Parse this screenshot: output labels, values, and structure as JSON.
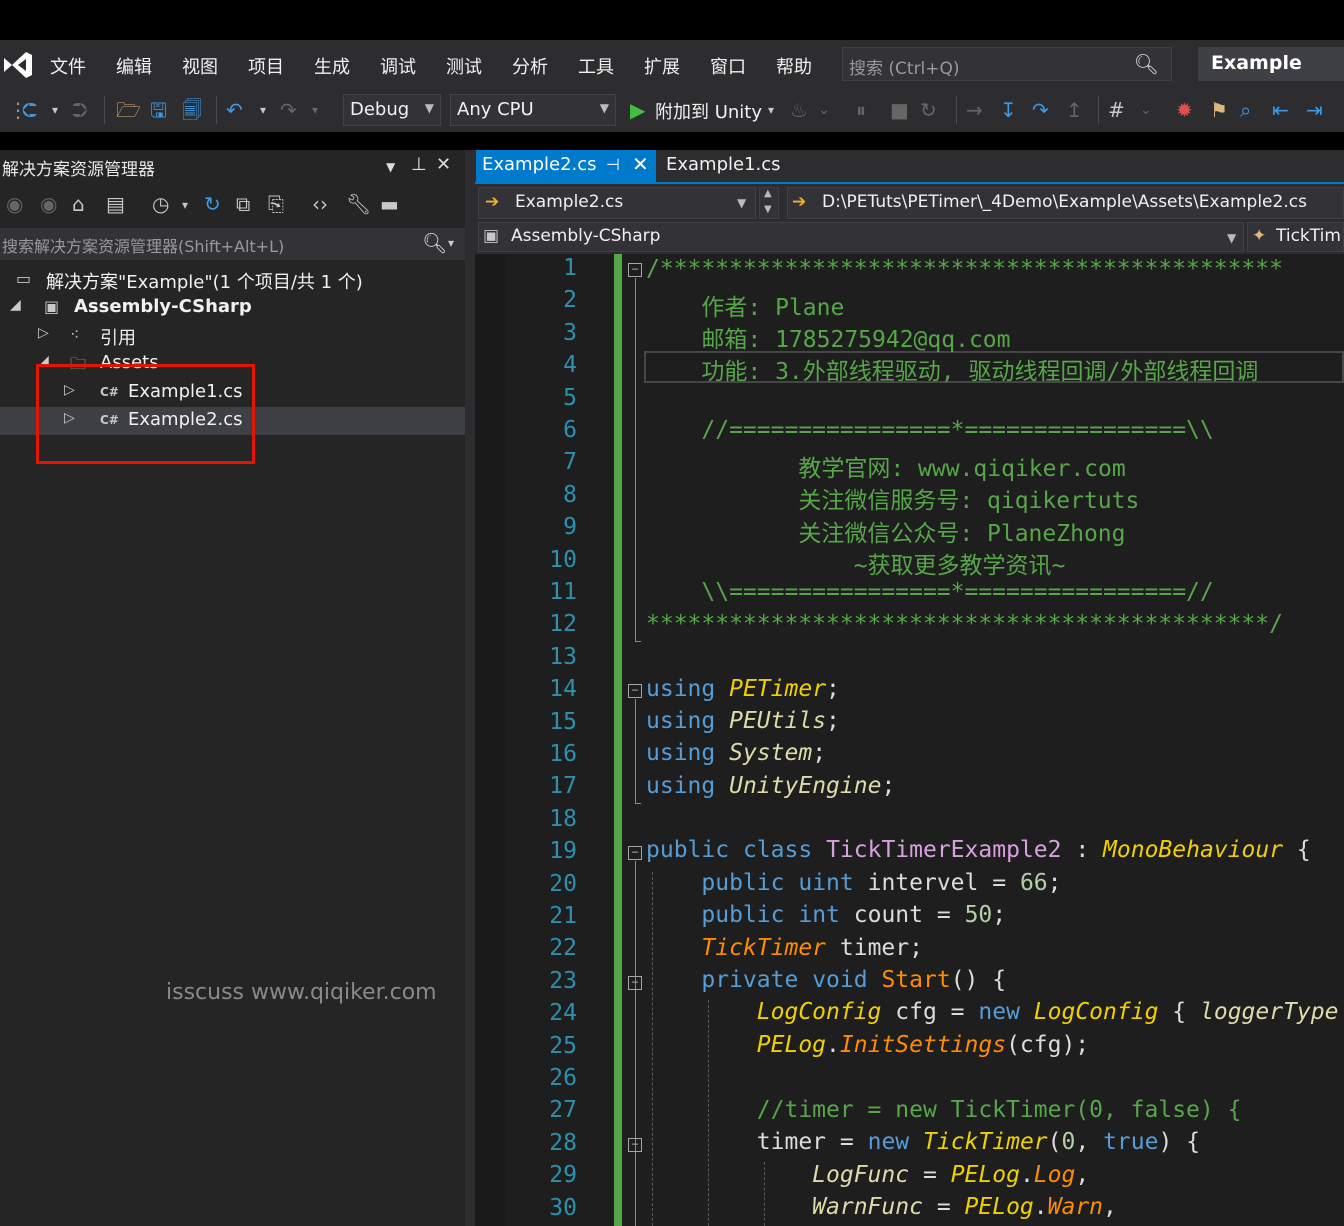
{
  "menu": {
    "items": [
      "文件",
      "编辑",
      "视图",
      "项目",
      "生成",
      "调试",
      "测试",
      "分析",
      "工具",
      "扩展",
      "窗口",
      "帮助"
    ],
    "search_placeholder": "搜索 (Ctrl+Q)",
    "window_title": "Example"
  },
  "toolbar": {
    "config": "Debug",
    "platform": "Any CPU",
    "attach_label": "附加到 Unity"
  },
  "solution_explorer": {
    "title": "解决方案资源管理器",
    "search_placeholder": "搜索解决方案资源管理器(Shift+Alt+L)",
    "solution": "解决方案\"Example\"(1 个项目/共 1 个)",
    "project": "Assembly-CSharp",
    "references": "引用",
    "assets": "Assets",
    "file1": "Example1.cs",
    "file2": "Example2.cs",
    "cs_badge": "C#"
  },
  "watermark": "isscuss www.qiqiker.com",
  "editor": {
    "active_tab": "Example2.cs",
    "inactive_tab": "Example1.cs",
    "nav_file": "Example2.cs",
    "nav_path": "D:\\PETuts\\PETimer\\_4Demo\\Example\\Assets\\Example2.cs",
    "nav_project": "Assembly-CSharp",
    "nav_member": "TickTim"
  },
  "code": {
    "l1": "/*********************************************",
    "l2": "    作者: Plane",
    "l3": "    邮箱: 1785275942@qq.com",
    "l4": "    功能: 3.外部线程驱动, 驱动线程回调/外部线程回调",
    "l6": "    //================*================\\\\",
    "l7": "           教学官网: www.qiqiker.com",
    "l8": "           关注微信服务号: qiqikertuts",
    "l9": "           关注微信公众号: PlaneZhong",
    "l10": "               ~获取更多教学资讯~",
    "l11": "    \\\\================*================//",
    "l12": "*********************************************/",
    "kw_using": "using",
    "ns1": "PETimer",
    "ns2": "PEUtils",
    "ns3": "System",
    "ns4": "UnityEngine",
    "semi": ";",
    "kw_public": "public",
    "kw_class": "class",
    "class_name": "TickTimerExample2",
    "colon": ":",
    "base_class": "MonoBehaviour",
    "brace_open": "{",
    "kw_uint": "uint",
    "f_intervel": "intervel",
    "eq": "=",
    "v66": "66",
    "kw_int": "int",
    "f_count": "count",
    "v50": "50",
    "t_ticktimer": "TickTimer",
    "f_timer": "timer",
    "kw_private": "private",
    "kw_void": "void",
    "m_start": "Start",
    "parens": "()",
    "t_logconfig": "LogConfig",
    "v_cfg": "cfg",
    "kw_new": "new",
    "f_loggertype": "loggerType",
    "t_pelog": "PELog",
    "m_initsettings": "InitSettings",
    "args_cfg": "(cfg);",
    "l27": "//timer = new TickTimer(0, false) {",
    "l28_a": "timer",
    "l28_args_open": "(",
    "l28_zero": "0",
    "comma": ",",
    "kw_true": "true",
    "l28_close": ")",
    "f_logfunc": "LogFunc",
    "m_log": "Log",
    "f_warnfunc": "WarnFunc",
    "m_warn": "Warn",
    "dot": "."
  },
  "line_numbers": [
    "1",
    "2",
    "3",
    "4",
    "5",
    "6",
    "7",
    "8",
    "9",
    "10",
    "11",
    "12",
    "13",
    "14",
    "15",
    "16",
    "17",
    "18",
    "19",
    "20",
    "21",
    "22",
    "23",
    "24",
    "25",
    "26",
    "27",
    "28",
    "29",
    "30"
  ],
  "colors": {
    "accent": "#007acc",
    "comment": "#57a64a",
    "keyword": "#569cd6",
    "line_number": "#2b91af",
    "highlight_box": "#e51400"
  }
}
